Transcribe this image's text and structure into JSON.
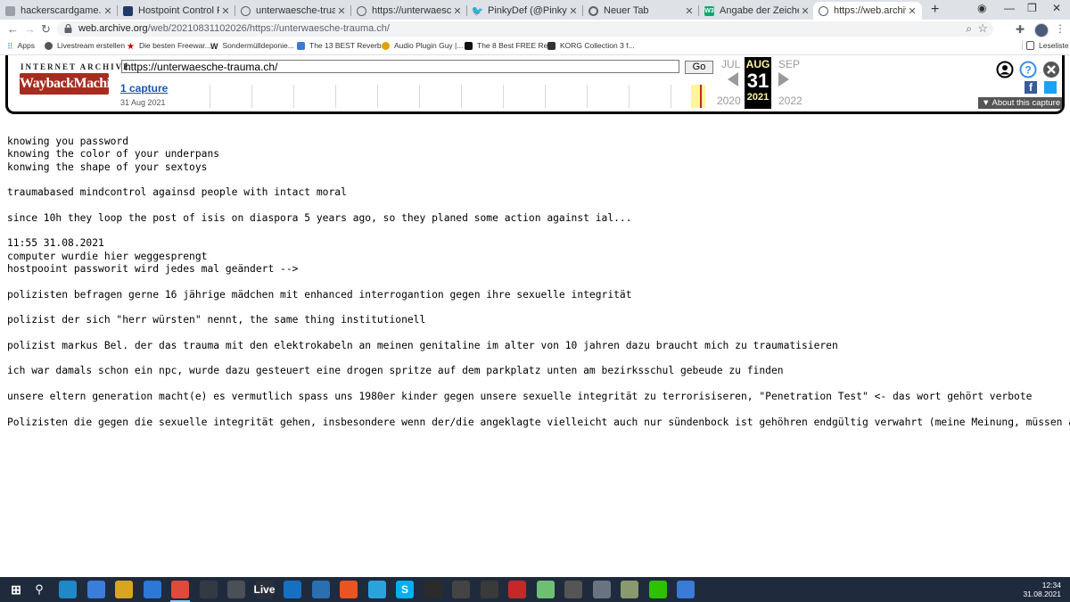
{
  "browser": {
    "tabs": [
      {
        "title": "hackerscardgame.ch/jpg/E",
        "favicon": "generic-page-icon",
        "color": "#5f6368"
      },
      {
        "title": "Hostpoint Control Panel -",
        "favicon": "hostpoint-icon",
        "color": "#1f3a68"
      },
      {
        "title": "unterwaesche-truama.ch",
        "favicon": "globe-icon",
        "color": "#5f6368"
      },
      {
        "title": "https://unterwaesche-trau",
        "favicon": "globe-icon",
        "color": "#5f6368"
      },
      {
        "title": "PinkyDef (@PinkyDef) / Tw",
        "favicon": "twitter-icon",
        "color": "#1da1f2"
      },
      {
        "title": "Neuer Tab",
        "favicon": "chrome-icon",
        "color": "#5f6368"
      },
      {
        "title": "Angabe der Zeichencodier",
        "favicon": "w3schools-icon",
        "color": "#04aa6d"
      },
      {
        "title": "https://web.archive.org/w",
        "favicon": "globe-icon",
        "color": "#5f6368",
        "active": true
      }
    ],
    "new_tab_label": "+",
    "url_host": "web.archive.org",
    "url_path": "/web/20210831102026/https://unterwaesche-trauma.ch/",
    "bookmarks": [
      {
        "label": "Apps",
        "color": "#4285f4"
      },
      {
        "label": "Livestream erstellen",
        "color": "#555555"
      },
      {
        "label": "Die besten Freewar...",
        "color": "#c00000"
      },
      {
        "label": "Sondermülldeponie...",
        "color": "#222222"
      },
      {
        "label": "The 13 BEST Reverb...",
        "color": "#3a7bd5"
      },
      {
        "label": "Audio Plugin Guy |...",
        "color": "#e0a000"
      },
      {
        "label": "The 8 Best FREE Re...",
        "color": "#111111"
      },
      {
        "label": "KORG Collection 3 f...",
        "color": "#333333"
      }
    ],
    "reading_list": "Leseliste"
  },
  "wayback": {
    "ia_label": "INTERNET ARCHIVE",
    "logo_text": "WaybackMachine",
    "url_value": "https://unterwaesche-trauma.ch/",
    "go_label": "Go",
    "captures": "1 capture",
    "capture_date": "31 Aug 2021",
    "prev_month": "JUL",
    "cur_month": "AUG",
    "next_month": "SEP",
    "day": "31",
    "prev_year": "2020",
    "cur_year": "2021",
    "next_year": "2022",
    "about": "About this capture"
  },
  "content": {
    "lines": [
      "knowing you password",
      "knowing the color of your underpans",
      "konwing the shape of your sextoys",
      "",
      "traumabased mindcontrol againsd people with intact moral",
      "",
      "since 10h they loop the post of isis on diaspora 5 years ago, so they planed some action against ial...",
      "",
      "11:55 31.08.2021",
      "computer wurdie hier weggesprengt",
      "hostpooint passworit wird jedes mal geändert -->",
      "",
      "polizisten befragen gerne 16 jährige mädchen mit enhanced interrogantion gegen ihre sexuelle integrität",
      "",
      "polizist der sich \"herr würsten\" nennt, the same thing institutionell",
      "",
      "polizist markus Bel. der das trauma mit den elektrokabeln an meinen genitaline im alter von 10 jahren dazu braucht mich zu traumatisieren",
      "",
      "ich war damals schon ein npc, wurde dazu gesteuert eine drogen spritze auf dem parkplatz unten am bezirksschul gebeude zu finden",
      "",
      "unsere eltern generation macht(e) es vermutlich spass uns 1980er kinder gegen unsere sexuelle integrität zu terrorisiseren, \"Penetration Test\" <- das wort gehört verbote",
      "",
      "Polizisten die gegen die sexuelle integrität gehen, insbesondere wenn der/die angeklagte vielleicht auch nur sündenbock ist gehöhren endgültig verwahrt (meine Meinung, müssen and"
    ]
  },
  "taskbar": {
    "time": "12:34",
    "date": "31.08.2021",
    "apps": [
      {
        "name": "edge-icon",
        "color": "#1e88c8"
      },
      {
        "name": "store-icon",
        "color": "#3b7dd8"
      },
      {
        "name": "files-icon",
        "color": "#d9a520"
      },
      {
        "name": "mail-icon",
        "color": "#2b78d6"
      },
      {
        "name": "chrome-icon",
        "color": "#e04a3a",
        "active": true
      },
      {
        "name": "app-icon-1",
        "color": "#333a44"
      },
      {
        "name": "app-icon-2",
        "color": "#4a4f58"
      },
      {
        "name": "live-icon",
        "color": "#2a2f38",
        "text": "Live"
      },
      {
        "name": "video-icon",
        "color": "#1670c2"
      },
      {
        "name": "app-icon-3",
        "color": "#2a6fb0"
      },
      {
        "name": "ubuntu-icon",
        "color": "#e95420"
      },
      {
        "name": "telegram-icon",
        "color": "#2aa3dd"
      },
      {
        "name": "skype-icon",
        "color": "#00aff0",
        "text": "S"
      },
      {
        "name": "app-icon-4",
        "color": "#2b2b2b"
      },
      {
        "name": "app-icon-5",
        "color": "#444444"
      },
      {
        "name": "app-icon-6",
        "color": "#3a3a3a"
      },
      {
        "name": "app-icon-7",
        "color": "#c62828"
      },
      {
        "name": "app-icon-8",
        "color": "#6fbf73"
      },
      {
        "name": "app-icon-9",
        "color": "#555555"
      },
      {
        "name": "app-icon-10",
        "color": "#6a7380"
      },
      {
        "name": "app-icon-11",
        "color": "#8a9a70"
      },
      {
        "name": "wechat-icon",
        "color": "#2dc100"
      },
      {
        "name": "app-icon-12",
        "color": "#3a7bd5"
      }
    ]
  }
}
